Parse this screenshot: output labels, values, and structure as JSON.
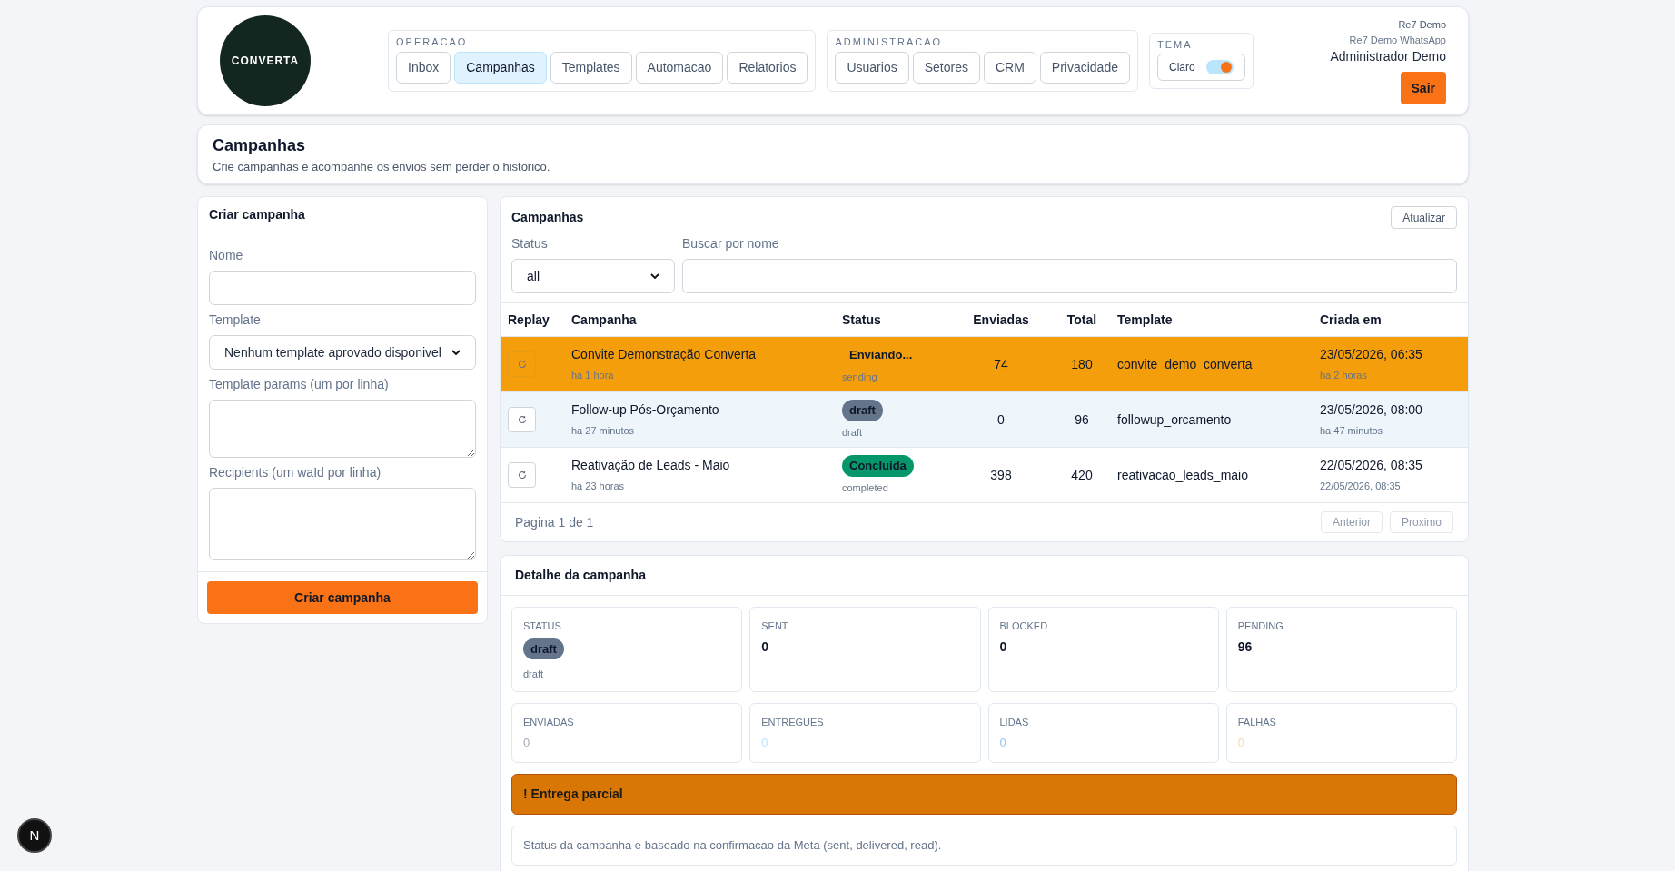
{
  "brand": {
    "logo_text": "CONVERTA"
  },
  "nav_groups": [
    {
      "label": "OPERACAO",
      "items": [
        {
          "label": "Inbox",
          "selected": false
        },
        {
          "label": "Campanhas",
          "selected": true
        },
        {
          "label": "Templates",
          "selected": false
        },
        {
          "label": "Automacao",
          "selected": false
        },
        {
          "label": "Relatorios",
          "selected": false
        }
      ]
    },
    {
      "label": "ADMINISTRACAO",
      "items": [
        {
          "label": "Usuarios",
          "selected": false
        },
        {
          "label": "Setores",
          "selected": false
        },
        {
          "label": "CRM",
          "selected": false
        },
        {
          "label": "Privacidade",
          "selected": false
        }
      ]
    }
  ],
  "theme": {
    "label": "TEMA",
    "option": "Claro",
    "on": true
  },
  "user": {
    "org": "Re7 Demo",
    "channel": "Re7 Demo WhatsApp",
    "name": "Administrador Demo",
    "logout": "Sair"
  },
  "page": {
    "title": "Campanhas",
    "subtitle": "Crie campanhas e acompanhe os envios sem perder o historico."
  },
  "create_form": {
    "title": "Criar campanha",
    "fields": [
      {
        "kind": "input",
        "label": "Nome"
      },
      {
        "kind": "select",
        "label": "Template",
        "value": "Nenhum template aprovado disponivel"
      },
      {
        "kind": "textarea",
        "label": "Template params (um por linha)"
      },
      {
        "kind": "textarea",
        "label": "Recipients (um waId por linha)"
      }
    ],
    "submit": "Criar campanha"
  },
  "campaigns": {
    "title": "Campanhas",
    "refresh": "Atualizar",
    "status_filter": {
      "label": "Status",
      "value": "all"
    },
    "search": {
      "label": "Buscar por nome"
    },
    "columns": [
      "Replay",
      "Campanha",
      "Status",
      "Enviadas",
      "Total",
      "Template",
      "Criada em"
    ],
    "rows": [
      {
        "name": "Convite Demonstração Converta",
        "age": "ha 1 hora",
        "status": {
          "kind": "sending",
          "label": "Enviando...",
          "raw": "sending"
        },
        "sent": "74",
        "total": "180",
        "template": "convite_demo_converta",
        "created": "23/05/2026, 06:35",
        "created_note": "ha 2 horas",
        "selected": false
      },
      {
        "name": "Follow-up Pós-Orçamento",
        "age": "ha 27 minutos",
        "status": {
          "kind": "draft",
          "label": "draft",
          "raw": "draft"
        },
        "sent": "0",
        "total": "96",
        "template": "followup_orcamento",
        "created": "23/05/2026, 08:00",
        "created_note": "ha 47 minutos",
        "selected": true
      },
      {
        "name": "Reativação de Leads - Maio",
        "age": "ha 23 horas",
        "status": {
          "kind": "completed",
          "label": "Concluida",
          "raw": "completed"
        },
        "sent": "398",
        "total": "420",
        "template": "reativacao_leads_maio",
        "created": "22/05/2026, 08:35",
        "created_note": "22/05/2026, 08:35",
        "selected": false
      }
    ],
    "pagination": {
      "text": "Pagina 1 de 1",
      "prev": {
        "label": "Anterior",
        "disabled": true
      },
      "next": {
        "label": "Proximo",
        "disabled": true
      }
    }
  },
  "detail": {
    "title": "Detalhe da campanha",
    "status": {
      "label": "STATUS",
      "badge": {
        "kind": "draft",
        "label": "draft"
      },
      "raw": "draft"
    },
    "stats": [
      {
        "label": "SENT",
        "value": "0"
      },
      {
        "label": "BLOCKED",
        "value": "0"
      },
      {
        "label": "PENDING",
        "value": "96"
      }
    ],
    "metrics": [
      {
        "label": "ENVIADAS",
        "value": "0",
        "color": "#a3adba"
      },
      {
        "label": "ENTREGUES",
        "value": "0",
        "color": "#bae6fd"
      },
      {
        "label": "LIDAS",
        "value": "0",
        "color": "#93c5fd"
      },
      {
        "label": "FALHAS",
        "value": "0",
        "color": "#fcd9a8"
      }
    ],
    "alert": "! Entrega parcial",
    "note": "Status da campanha e baseado na confirmacao da Meta (sent, delivered, read)."
  },
  "dev_badge": "N"
}
